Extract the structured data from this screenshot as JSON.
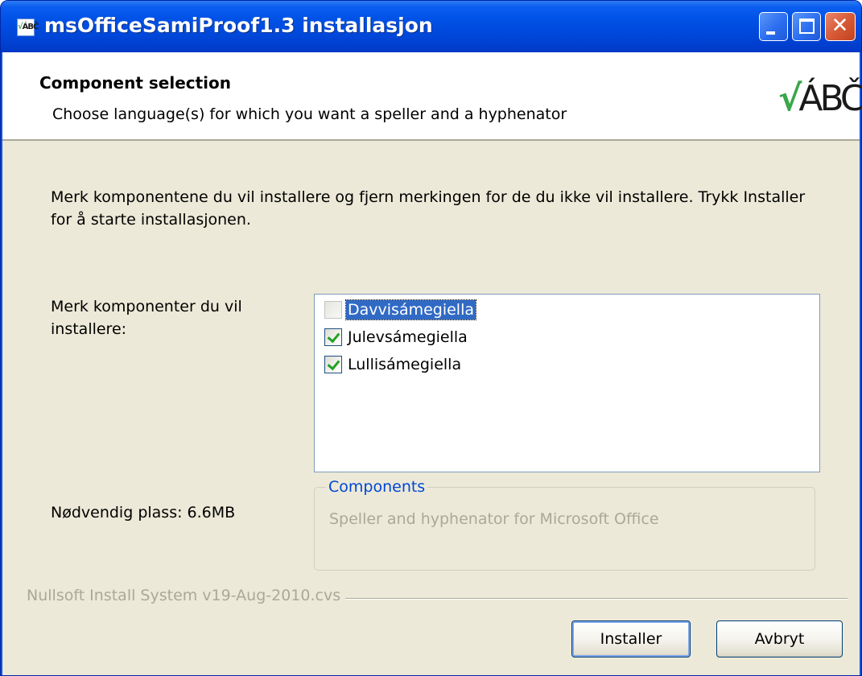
{
  "window": {
    "title": "msOfficeSamiProof1.3 installasjon",
    "icon_text": "ÁBČ",
    "colors": {
      "titlebar": "#0052e6",
      "close_button": "#d55734",
      "body_background": "#ece9d8",
      "selection": "#316ac5",
      "checkmark": "#21a121",
      "group_legend": "#0046d5"
    }
  },
  "titlebar_buttons": {
    "minimize_icon": "minimize-icon",
    "maximize_icon": "maximize-icon",
    "close_icon": "close-icon",
    "close_glyph": "✕"
  },
  "header": {
    "title": "Component selection",
    "subtitle": "Choose language(s) for which you want a speller and a hyphenator",
    "logo_check": "√",
    "logo_text": "ÁBČ"
  },
  "body": {
    "intro": "Merk komponentene du vil installere og fjern merkingen for de du ikke vil installere. Trykk Installer for å starte installasjonen.",
    "select_label": "Merk komponenter du vil installere:",
    "space_required": "Nødvendig plass: 6.6MB"
  },
  "components": [
    {
      "label": "Davvisámegiella",
      "checked": false,
      "selected": true
    },
    {
      "label": "Julevsámegiella",
      "checked": true,
      "selected": false
    },
    {
      "label": "Lullisámegiella",
      "checked": true,
      "selected": false
    }
  ],
  "description_group": {
    "legend": "Components",
    "text": "Speller and hyphenator for Microsoft Office"
  },
  "footer": {
    "branding": "Nullsoft Install System v19-Aug-2010.cvs",
    "install_label": "Installer",
    "cancel_label": "Avbryt"
  }
}
